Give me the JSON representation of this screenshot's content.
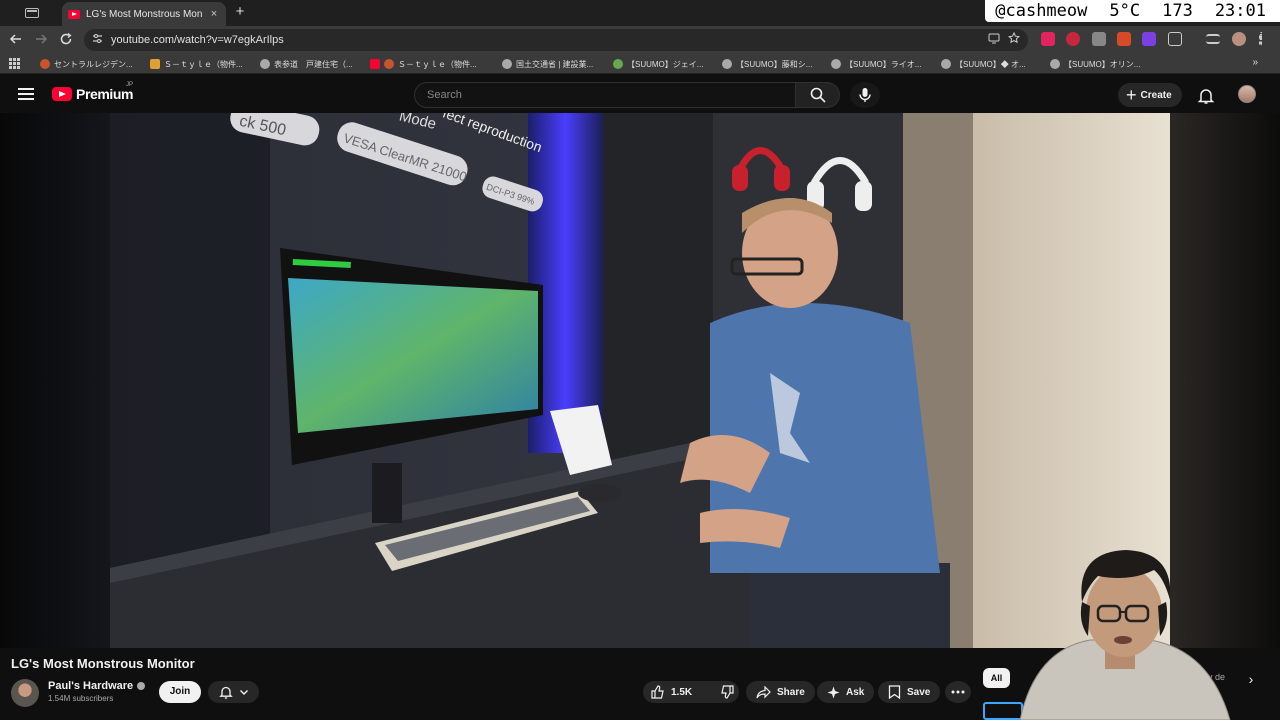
{
  "browser": {
    "tab_title": "LG's Most Monstrous Monitor",
    "tab_close": "×",
    "new_tab": "+",
    "url": "youtube.com/watch?v=w7egkArIlps",
    "bookmarks": [
      "セントラルレジデン...",
      "Ｓ－ｔｙｌｅ（物件...",
      "表参道　戸建住宅（...",
      "Ｓ－ｔｙｌｅ（物件...",
      "国土交通省 | 建設業...",
      "【SUUMO】ジェイ...",
      "【SUUMO】藤和シ...",
      "【SUUMO】ライオ...",
      "【SUUMO】◆ オ...",
      "【SUUMO】オリン..."
    ],
    "bookmarks_more": "»"
  },
  "status": {
    "user": "@cashmeow",
    "temperature": "5°C",
    "counter": "173",
    "time": "23:01"
  },
  "youtube": {
    "logo_text": "Premium",
    "logo_region": "JP",
    "search_placeholder": "Search",
    "create_label": "Create"
  },
  "video": {
    "title": "LG's Most Monstrous Monitor",
    "channel": "Paul's Hardware",
    "subscribers": "1.54M subscribers",
    "join_label": "Join",
    "likes": "1.5K",
    "share_label": "Share",
    "ask_label": "Ask",
    "save_label": "Save",
    "scene_text": {
      "sign1": "ck 500",
      "sign2": "VESA ClearMR 21000",
      "sign3": "DCI-P3 99%",
      "sign4": "Mode",
      "sign5": "fect reproduction"
    }
  },
  "chips": {
    "all_label": "All",
    "partial_label": "y de"
  }
}
